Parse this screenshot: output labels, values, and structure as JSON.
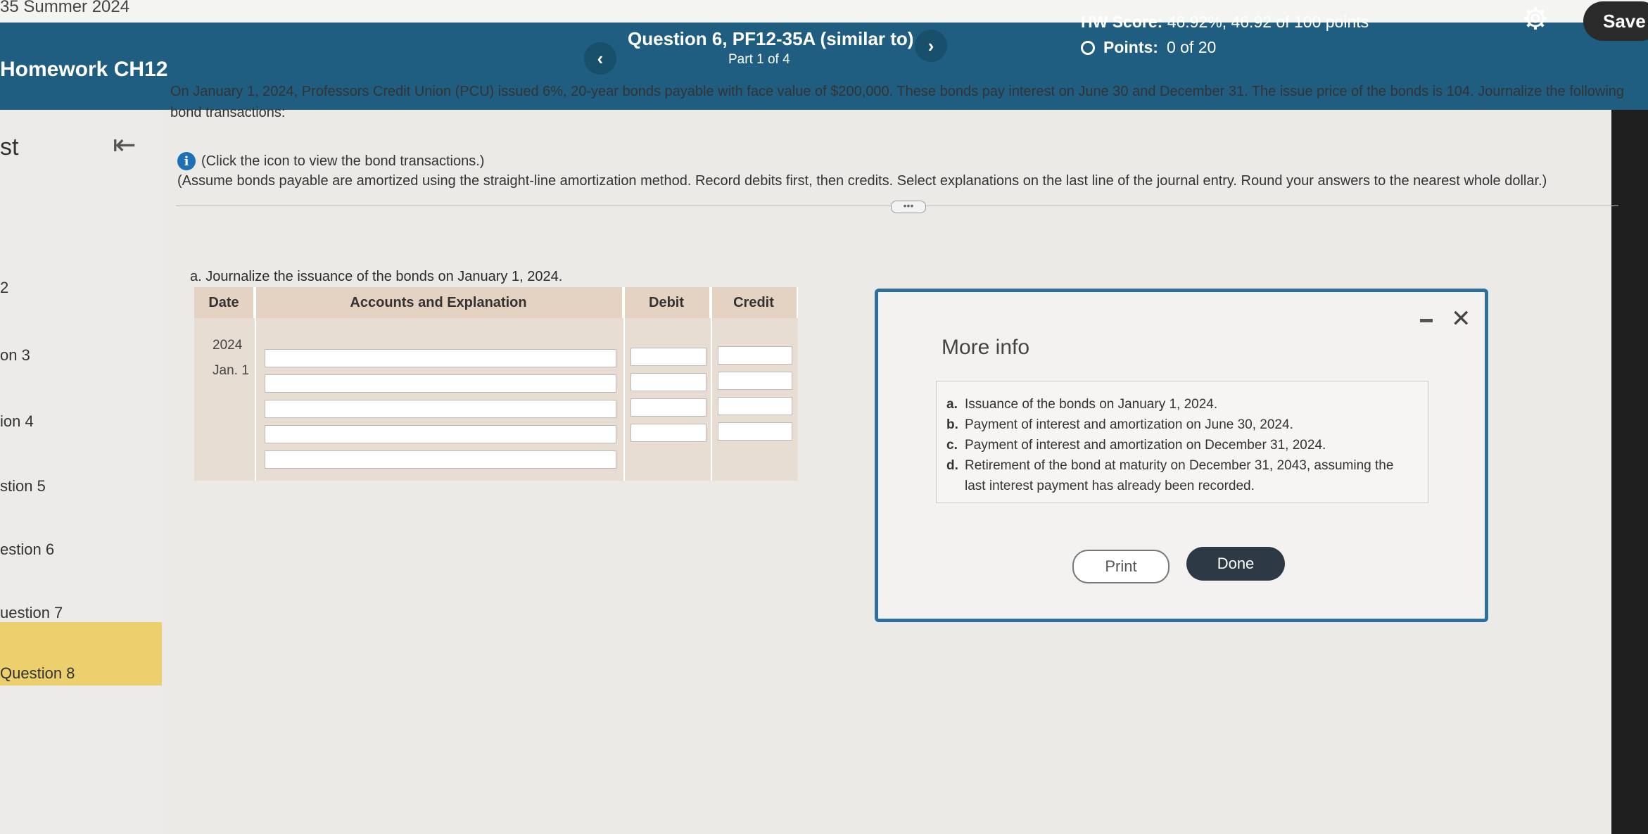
{
  "course_title": "35 Summer 2024",
  "header": {
    "homework_title": "Homework CH12",
    "question_title": "Question 6, PF12-35A (similar to)",
    "part": "Part 1 of 4",
    "hw_score_label": "HW Score:",
    "hw_score_value": "46.92%, 46.92 of 100 points",
    "points_label": "Points:",
    "points_value": "0 of 20",
    "save_label": "Save"
  },
  "sidebar": {
    "items": [
      "st",
      "2",
      "on 3",
      "ion 4",
      "stion 5",
      "estion 6",
      "uestion 7",
      "Question 8"
    ]
  },
  "problem": {
    "text": "On January 1, 2024, Professors Credit Union (PCU) issued 6%, 20-year bonds payable with face value of $200,000. These bonds pay interest on June 30 and December 31. The issue price of the bonds is 104. Journalize the following bond transactions:",
    "info_link": "(Click the icon to view the bond transactions.)",
    "assume": "(Assume bonds payable are amortized using the straight-line amortization method. Record debits first, then credits. Select explanations on the last line of the journal entry. Round your answers to the nearest whole dollar.)",
    "expander": "•••"
  },
  "journal": {
    "prompt": "a. Journalize the issuance of the bonds on January 1, 2024.",
    "headers": [
      "Date",
      "Accounts and Explanation",
      "Debit",
      "Credit"
    ],
    "year": "2024",
    "date": "Jan. 1"
  },
  "modal": {
    "title": "More info",
    "items": [
      {
        "letter": "a.",
        "text": "Issuance of the bonds on January 1, 2024."
      },
      {
        "letter": "b.",
        "text": "Payment of interest and amortization on June 30, 2024."
      },
      {
        "letter": "c.",
        "text": "Payment of interest and amortization on December 31, 2024."
      },
      {
        "letter": "d.",
        "text": "Retirement of the bond at maturity on December 31, 2043, assuming the last interest payment has already been recorded."
      }
    ],
    "print_label": "Print",
    "done_label": "Done"
  }
}
